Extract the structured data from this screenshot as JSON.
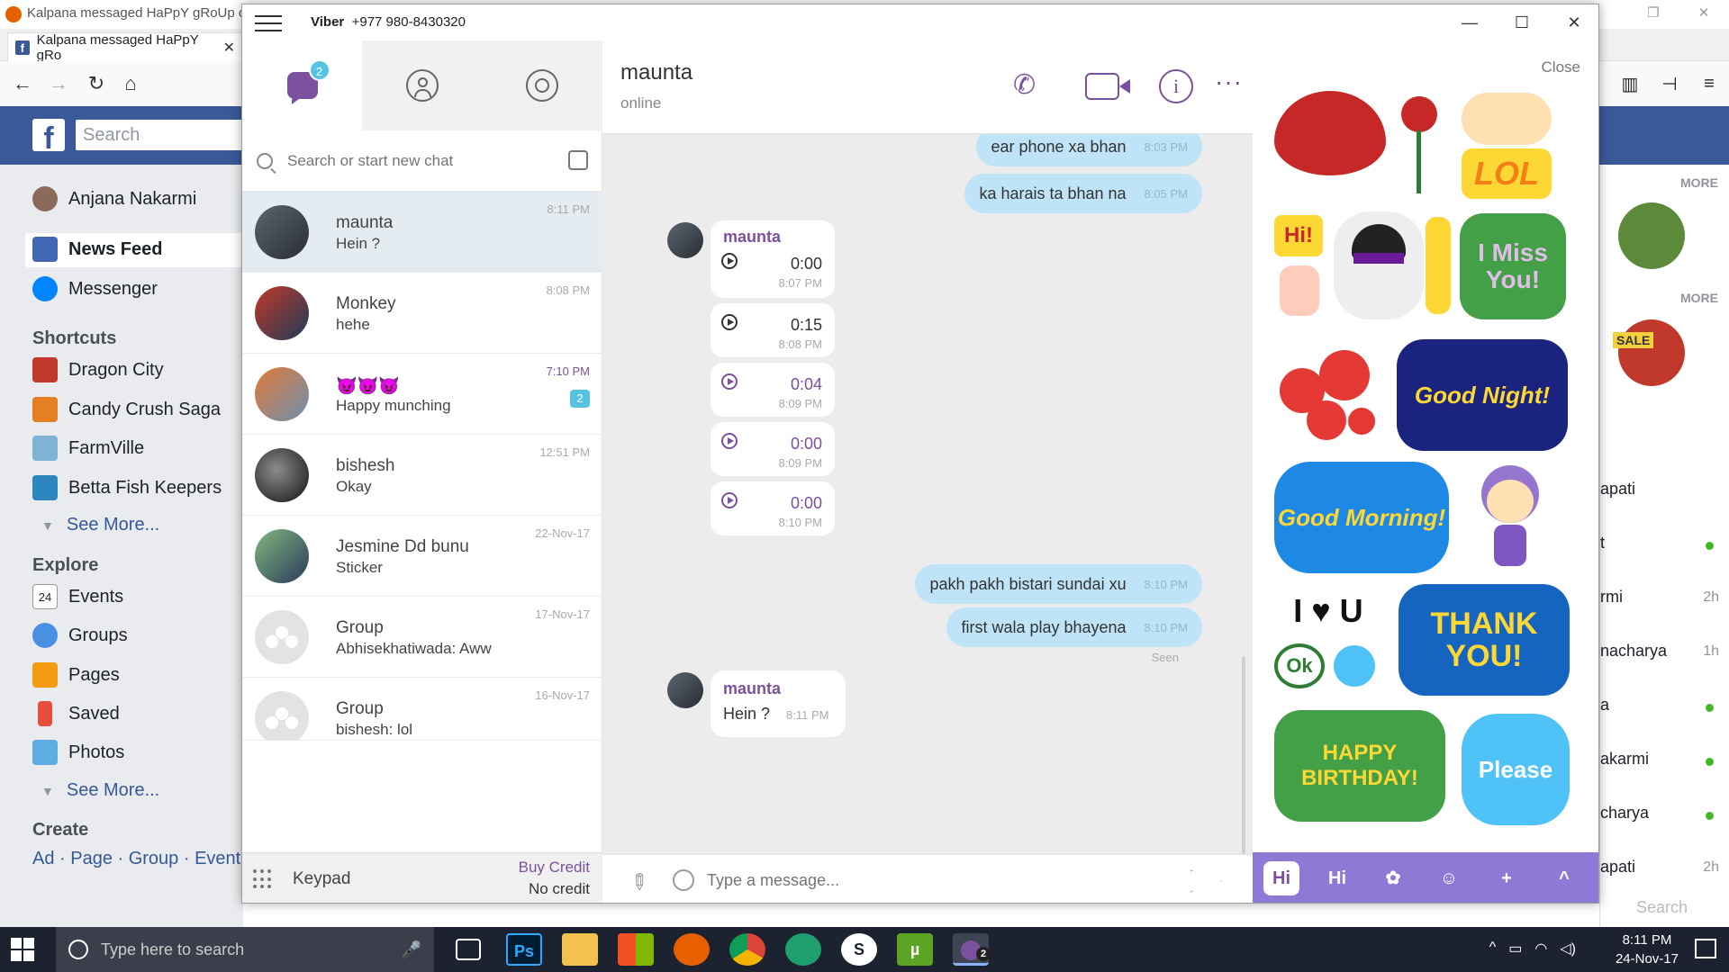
{
  "browser": {
    "window_tab_title": "Kalpana messaged HaPpY gRoUp ch",
    "tab_title": "Kalpana messaged HaPpY gRo"
  },
  "facebook": {
    "search_placeholder": "Search",
    "user_name": "Anjana Nakarmi",
    "nav": [
      "News Feed",
      "Messenger"
    ],
    "shortcuts_title": "Shortcuts",
    "shortcuts": [
      "Dragon City",
      "Candy Crush Saga",
      "FarmVille",
      "Betta Fish Keepers"
    ],
    "see_more": "See More...",
    "explore_title": "Explore",
    "explore": [
      "Events",
      "Groups",
      "Pages",
      "Saved",
      "Photos"
    ],
    "explore_icon_text": "24",
    "create_title": "Create",
    "create_links": "Ad · Page · Group · Event",
    "right_more": "MORE",
    "sale_label": "SALE",
    "contacts": [
      {
        "name": "apati",
        "time": ""
      },
      {
        "name": "t",
        "time": ""
      },
      {
        "name": "rmi",
        "time": "2h"
      },
      {
        "name": "nacharya",
        "time": "1h"
      },
      {
        "name": "a",
        "time": ""
      },
      {
        "name": "akarmi",
        "time": ""
      },
      {
        "name": "charya",
        "time": ""
      },
      {
        "name": "apati",
        "time": "2h"
      }
    ],
    "right_search": "Search"
  },
  "viber": {
    "title_app": "Viber",
    "title_phone": "+977 980-8430320",
    "chat_badge": "2",
    "search_placeholder": "Search or start new chat",
    "conversations": [
      {
        "name": "maunta",
        "preview": "Hein ?",
        "time": "8:11 PM"
      },
      {
        "name": "Monkey",
        "preview": "hehe",
        "time": "8:08 PM"
      },
      {
        "name": "😈😈😈",
        "preview": "Happy munching",
        "time": "7:10 PM",
        "unread": "2"
      },
      {
        "name": "bishesh",
        "preview": "Okay",
        "time": "12:51 PM"
      },
      {
        "name": "Jesmine Dd bunu",
        "preview": "Sticker",
        "time": "22-Nov-17"
      },
      {
        "name": "Group",
        "preview": "Abhisekhatiwada: Aww",
        "time": "17-Nov-17"
      },
      {
        "name": "Group",
        "preview": "bishesh: lol",
        "time": "16-Nov-17"
      }
    ],
    "keypad_label": "Keypad",
    "buy_credit": "Buy Credit",
    "no_credit": "No credit",
    "contact_name": "maunta",
    "contact_status": "online",
    "messages_out_top": [
      {
        "text": "ear phone xa bhan",
        "time": "8:03 PM"
      },
      {
        "text": "ka harais ta bhan na",
        "time": "8:05 PM"
      }
    ],
    "sender_name": "maunta",
    "voice_messages": [
      {
        "duration": "0:00",
        "time": "8:07 PM"
      },
      {
        "duration": "0:15",
        "time": "8:08 PM"
      },
      {
        "duration": "0:04",
        "time": "8:09 PM"
      },
      {
        "duration": "0:00",
        "time": "8:09 PM"
      },
      {
        "duration": "0:00",
        "time": "8:10 PM"
      }
    ],
    "messages_out_bottom": [
      {
        "text": "pakh pakh bistari sundai xu",
        "time": "8:10 PM"
      },
      {
        "text": "first wala play bhayena",
        "time": "8:10 PM"
      }
    ],
    "seen_label": "Seen",
    "last_in": {
      "sender": "maunta",
      "text": "Hein ?",
      "time": "8:11 PM"
    },
    "input_placeholder": "Type a message...",
    "sticker_close": "Close",
    "stickers": [
      "Hi!",
      "LOL",
      "I Miss You!",
      "Good Night!",
      "Good Morning!",
      "I ♥ U",
      "Ok",
      "THANK YOU!",
      "HAPPY BIRTHDAY!",
      "Please"
    ],
    "sticker_tabs": [
      "Hi",
      "Hi",
      "+",
      "^"
    ]
  },
  "taskbar": {
    "search_placeholder": "Type here to search",
    "time": "8:11 PM",
    "date": "24-Nov-17",
    "ps_label": "Ps",
    "viber_badge": "2"
  }
}
